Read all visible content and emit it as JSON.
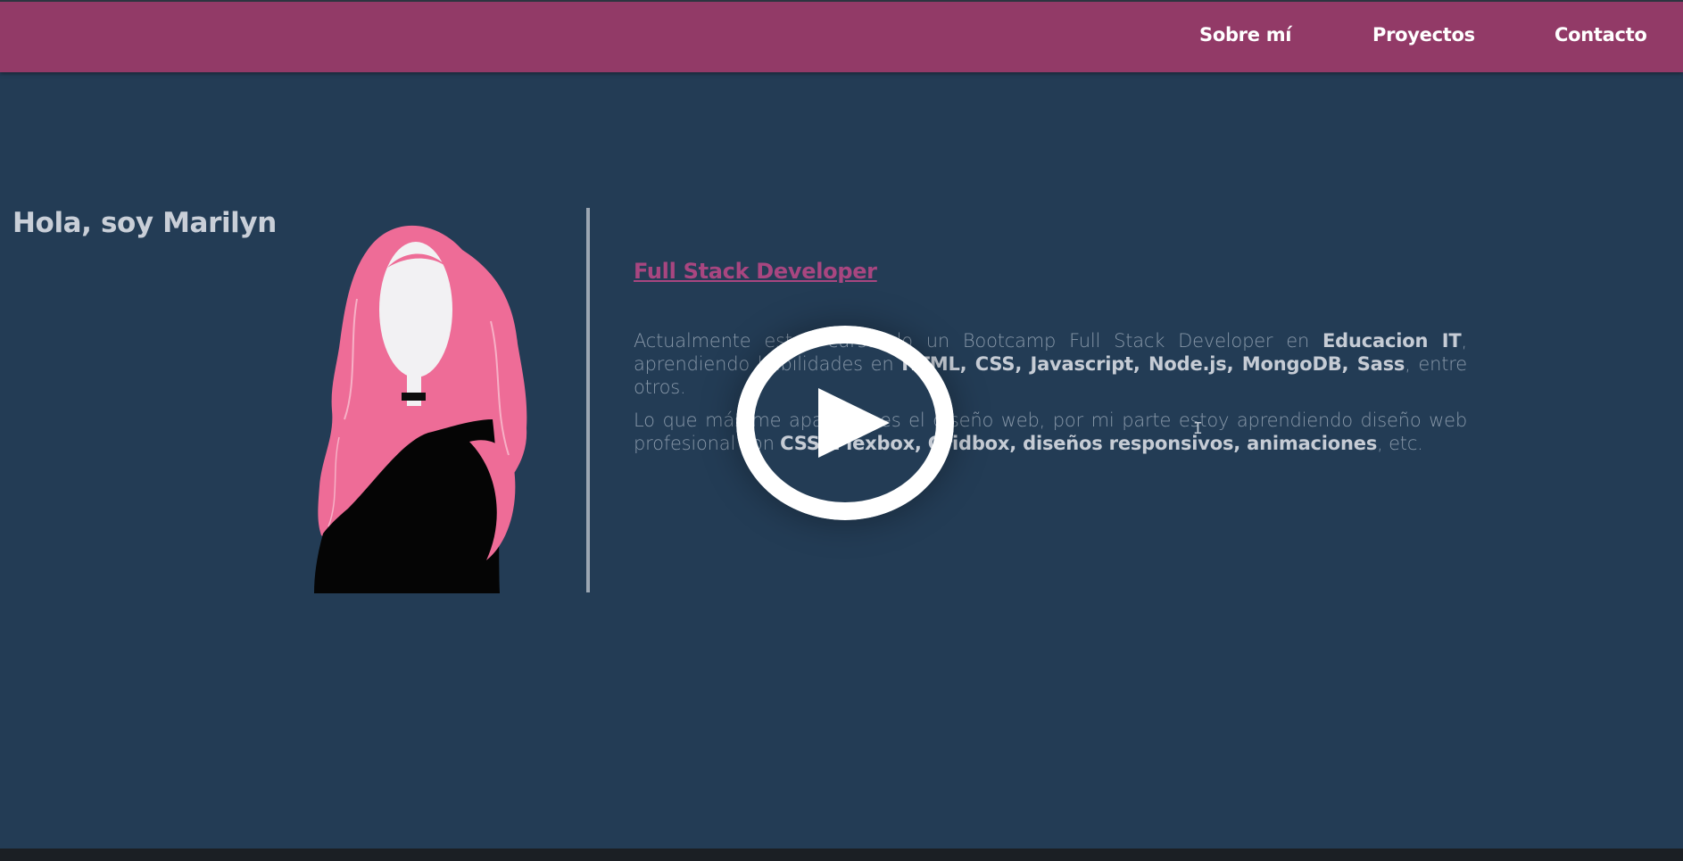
{
  "nav": {
    "about": "Sobre mí",
    "projects": "Proyectos",
    "contact": "Contacto"
  },
  "hero": {
    "greeting": "Hola, soy Marilyn",
    "avatar_icon": "woman-illustration-icon",
    "role_title": "Full Stack Developer",
    "paragraph1": {
      "t1": "Actualmente estoy cursando un Bootcamp Full Stack Developer en ",
      "b1": "Educacion IT",
      "t2": ", aprendiendo habilidades en ",
      "b2": "HTML, CSS, Javascript, Node.js, MongoDB, Sass",
      "t3": ", entre otros."
    },
    "paragraph2": {
      "t1": "Lo que más me apasiona es el diseño web, por mi parte estoy aprendiendo diseño web profesional con ",
      "b1": "CSS: Flexbox, Gridbox, diseños responsivos, animaciones",
      "t2": ", etc."
    }
  },
  "overlay": {
    "play_icon": "play-icon"
  },
  "colors": {
    "background": "#233c55",
    "header": "#923a67",
    "accent": "#a84680",
    "hair": "#ee6c97"
  }
}
